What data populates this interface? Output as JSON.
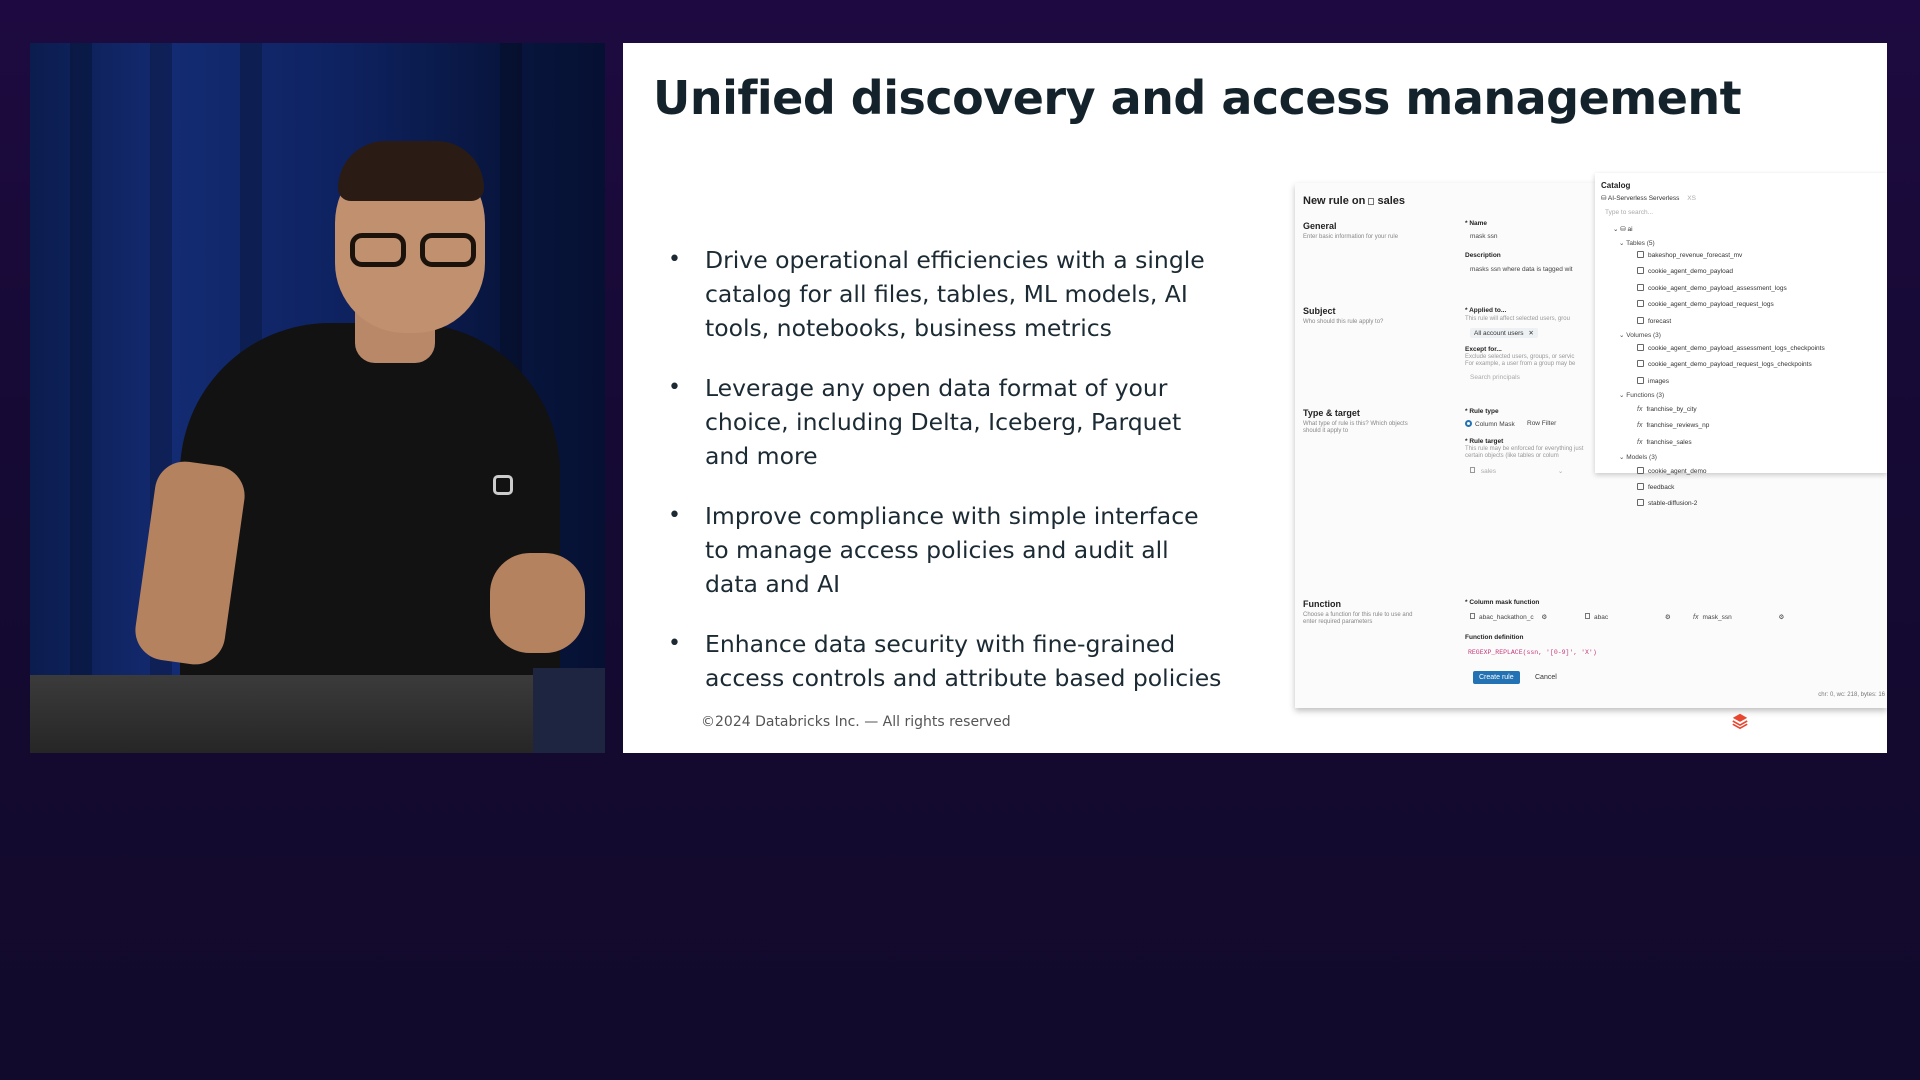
{
  "slide": {
    "title": "Unified discovery and access management",
    "bullets": [
      "Drive operational efficiencies with a single catalog for all files, tables, ML models, AI tools, notebooks, business metrics",
      "Leverage any open data format of your choice, including Delta, Iceberg, Parquet and more",
      "Improve compliance with simple interface to manage access policies and audit all data and AI",
      "Enhance data security with fine-grained access controls and attribute based policies"
    ],
    "bullet_symbol": "•",
    "footer": "©2024 Databricks Inc. — All rights reserved"
  },
  "rule_form": {
    "title": "New rule on",
    "table_name": "sales",
    "sections": {
      "general": {
        "heading": "General",
        "description": "Enter basic information for your rule"
      },
      "subject": {
        "heading": "Subject",
        "description": "Who should this rule apply to?"
      },
      "type_target": {
        "heading": "Type & target",
        "description": "What type of rule is this? Which objects should it apply to"
      },
      "function": {
        "heading": "Function",
        "description": "Choose a function for this rule to use and enter required parameters"
      }
    },
    "name_label": "* Name",
    "name_value": "mask ssn",
    "description_label": "Description",
    "description_value": "masks ssn where data is tagged wit",
    "applied_label": "* Applied to...",
    "applied_description": "This rule will affect selected users, grou",
    "applied_chip": "All account users",
    "chip_remove": "✕",
    "except_label": "Except for...",
    "except_description": "Exclude selected users, groups, or servic For example, a user from a group may be",
    "except_placeholder": "Search principals",
    "rule_type_label": "* Rule type",
    "rule_type_options": [
      "Column Mask",
      "Row Filter"
    ],
    "rule_target_label": "* Rule target",
    "rule_target_description": "This rule may be enforced for everything just certain objects (like tables or colum",
    "rule_target_value": "sales",
    "column_mask_label": "* Column mask function",
    "mask_fn_parts": [
      "abac_hackathon_c",
      "abac",
      "mask_ssn"
    ],
    "function_def_label": "Function definition",
    "function_def_code": "REGEXP_REPLACE(ssn, '[0-9]', 'X')",
    "create_button": "Create rule",
    "cancel_button": "Cancel",
    "status_text": "chr: 0, wc: 218, bytes: 16"
  },
  "catalog": {
    "title": "Catalog",
    "compute": "AI-Serverless  Serverless",
    "size_badge": "XS",
    "search_placeholder": "Type to search...",
    "root": "ai",
    "groups": [
      {
        "label": "Tables (5)",
        "items": [
          "bakeshop_revenue_forecast_mv",
          "cookie_agent_demo_payload",
          "cookie_agent_demo_payload_assessment_logs",
          "cookie_agent_demo_payload_request_logs",
          "forecast"
        ]
      },
      {
        "label": "Volumes (3)",
        "items": [
          "cookie_agent_demo_payload_assessment_logs_checkpoints",
          "cookie_agent_demo_payload_request_logs_checkpoints",
          "images"
        ]
      },
      {
        "label": "Functions (3)",
        "items": [
          "franchise_by_city",
          "franchise_reviews_np",
          "franchise_sales"
        ]
      },
      {
        "label": "Models (3)",
        "items": [
          "cookie_agent_demo",
          "feedback",
          "stable-diffusion-2"
        ]
      }
    ]
  }
}
